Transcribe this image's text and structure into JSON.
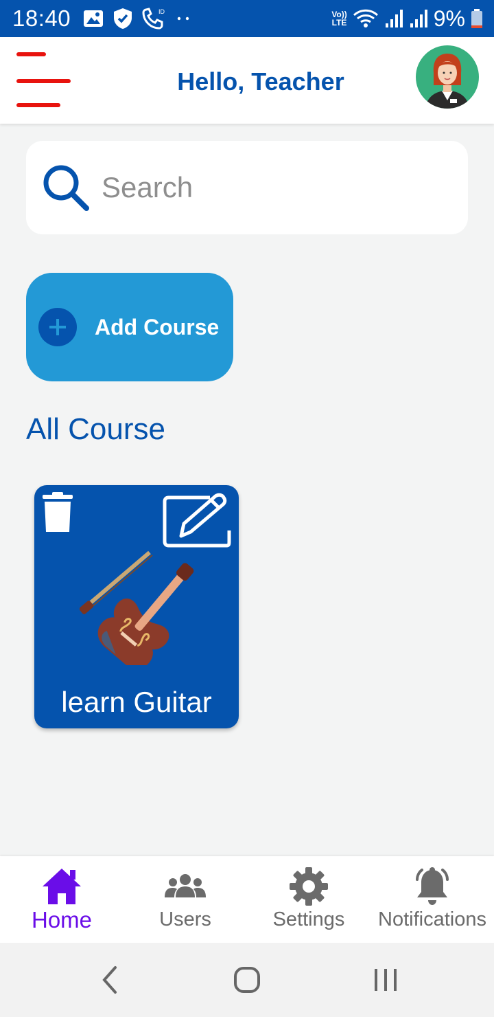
{
  "status_bar": {
    "time": "18:40",
    "battery_text": "9%",
    "network_label_top": "Vo))",
    "network_label_bottom": "LTE",
    "icons": [
      "image-icon",
      "shield-icon",
      "phone-id-icon",
      "wifi-icon",
      "signal-icon",
      "battery-icon"
    ]
  },
  "header": {
    "title": "Hello, Teacher",
    "menu_color": "#e8130e",
    "avatar_icon": "teacher-avatar"
  },
  "search": {
    "placeholder": "Search"
  },
  "add_course": {
    "label": "Add Course"
  },
  "section": {
    "title": "All Course"
  },
  "courses": [
    {
      "title": "learn Guitar",
      "image_icon": "violin-icon"
    }
  ],
  "bottom_nav": {
    "items": [
      {
        "label": "Home",
        "icon": "home-icon",
        "active": true
      },
      {
        "label": "Users",
        "icon": "users-icon",
        "active": false
      },
      {
        "label": "Settings",
        "icon": "gear-icon",
        "active": false
      },
      {
        "label": "Notifications",
        "icon": "bell-icon",
        "active": false
      }
    ]
  },
  "colors": {
    "brand_blue": "#0553ad",
    "accent_blue": "#2399d6",
    "active_purple": "#6a0de8",
    "background": "#f3f4f4"
  }
}
